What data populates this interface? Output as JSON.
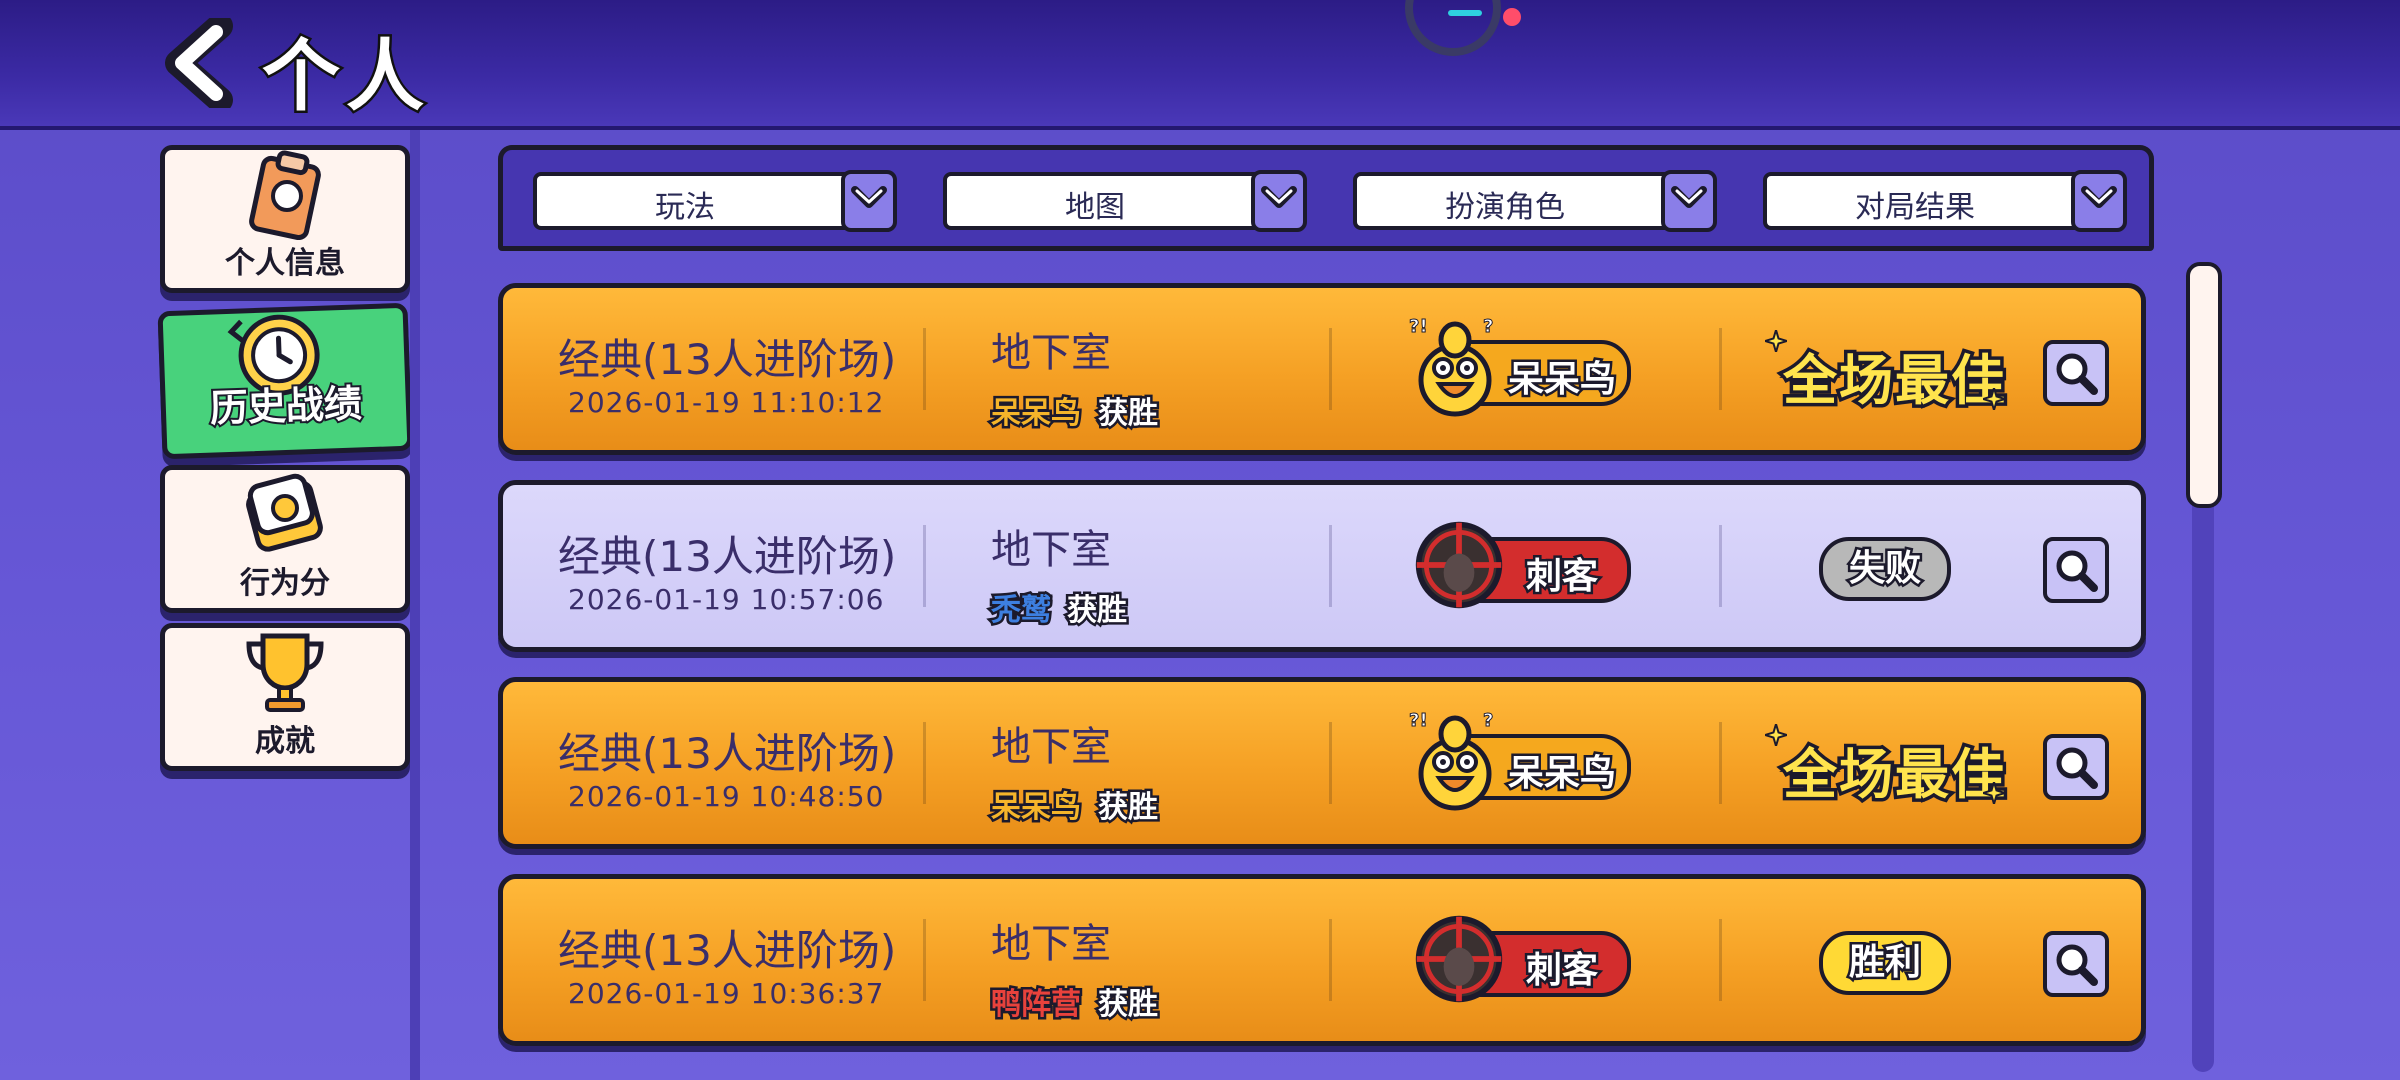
{
  "header": {
    "title": "个人"
  },
  "sidebar": {
    "items": [
      {
        "label": "个人信息",
        "icon": "clipboard-icon",
        "active": false
      },
      {
        "label": "历史战绩",
        "icon": "clock-icon",
        "active": true
      },
      {
        "label": "行为分",
        "icon": "score-card-icon",
        "active": false
      },
      {
        "label": "成就",
        "icon": "trophy-icon",
        "active": false
      }
    ]
  },
  "filters": [
    {
      "label": "玩法"
    },
    {
      "label": "地图"
    },
    {
      "label": "扮演角色"
    },
    {
      "label": "对局结果"
    }
  ],
  "matches": [
    {
      "mode": "经典(13人进阶场)",
      "time": "2026-01-19 11:10:12",
      "map": "地下室",
      "winner": "呆呆鸟",
      "winner_color": "#f5b52a",
      "win_suffix": "获胜",
      "role": "呆呆鸟",
      "role_type": "duck",
      "result": "全场最佳",
      "result_type": "mvp",
      "style": "gold"
    },
    {
      "mode": "经典(13人进阶场)",
      "time": "2026-01-19 10:57:06",
      "map": "地下室",
      "winner": "秃鹫",
      "winner_color": "#3d7fe0",
      "win_suffix": "获胜",
      "role": "刺客",
      "role_type": "assassin",
      "result": "失败",
      "result_type": "lose",
      "style": "lav"
    },
    {
      "mode": "经典(13人进阶场)",
      "time": "2026-01-19 10:48:50",
      "map": "地下室",
      "winner": "呆呆鸟",
      "winner_color": "#f5b52a",
      "win_suffix": "获胜",
      "role": "呆呆鸟",
      "role_type": "duck",
      "result": "全场最佳",
      "result_type": "mvp",
      "style": "gold"
    },
    {
      "mode": "经典(13人进阶场)",
      "time": "2026-01-19 10:36:37",
      "map": "地下室",
      "winner": "鸭阵营",
      "winner_color": "#e8423c",
      "win_suffix": "获胜",
      "role": "刺客",
      "role_type": "assassin",
      "result": "胜利",
      "result_type": "win",
      "style": "gold"
    }
  ]
}
